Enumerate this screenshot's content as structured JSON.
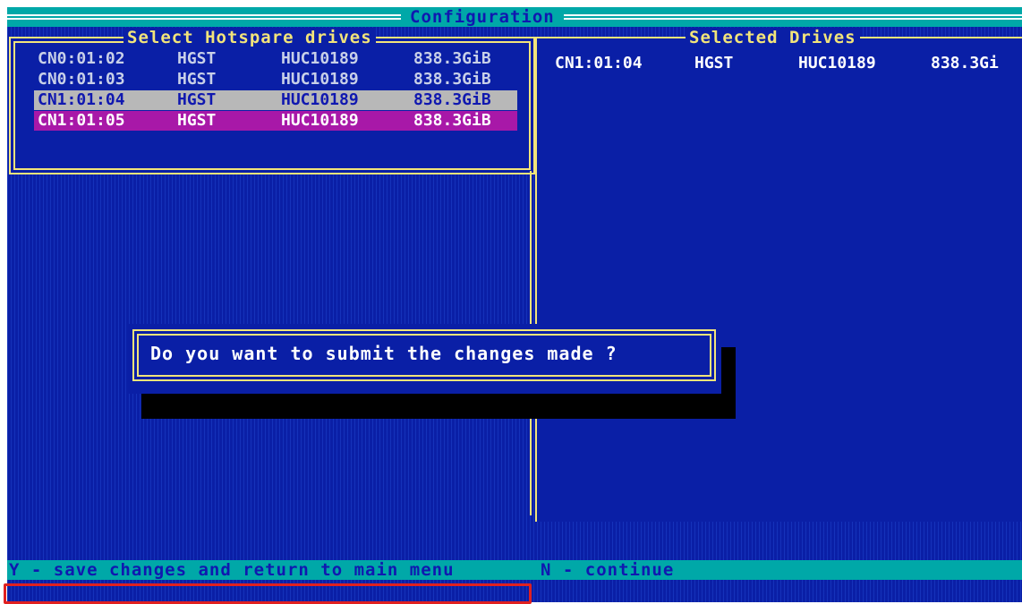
{
  "window": {
    "title": "Configuration"
  },
  "left_panel": {
    "title": "Select Hotspare drives",
    "drives": [
      {
        "id": "CN0:01:02",
        "vendor": "HGST",
        "model": "HUC10189",
        "size": "838.3GiB",
        "state": "normal"
      },
      {
        "id": "CN0:01:03",
        "vendor": "HGST",
        "model": "HUC10189",
        "size": "838.3GiB",
        "state": "normal"
      },
      {
        "id": "CN1:01:04",
        "vendor": "HGST",
        "model": "HUC10189",
        "size": "838.3GiB",
        "state": "selected"
      },
      {
        "id": "CN1:01:05",
        "vendor": "HGST",
        "model": "HUC10189",
        "size": "838.3GiB",
        "state": "cursor"
      }
    ]
  },
  "right_panel": {
    "title": "Selected Drives",
    "drives": [
      {
        "id": "CN1:01:04",
        "vendor": "HGST",
        "model": "HUC10189",
        "size": "838.3Gi"
      }
    ]
  },
  "dialog": {
    "message": "Do you want to submit the changes made ?"
  },
  "statusbar": {
    "yes_hint": "Y - save changes and return to main menu",
    "no_hint": "N - continue"
  },
  "colors": {
    "background": "#0a1fa6",
    "frame": "#f2e47a",
    "bar": "#00a8a8",
    "selected_row": "#b8b8b8",
    "cursor_row": "#a818a8",
    "highlight": "#e02020"
  }
}
